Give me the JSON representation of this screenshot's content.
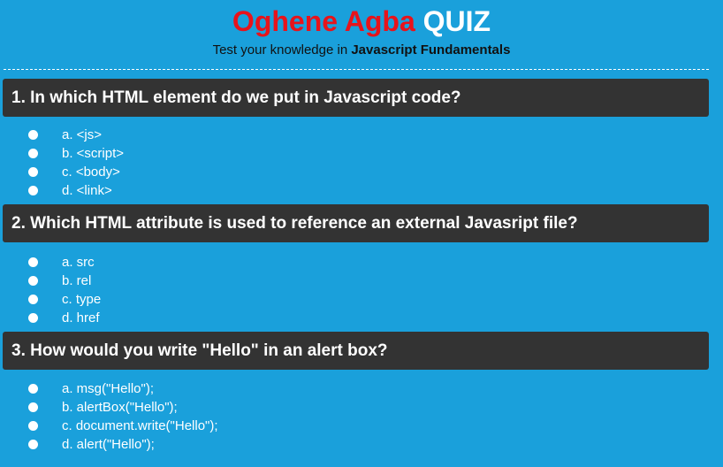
{
  "header": {
    "title_name": "Oghene Agba",
    "title_quiz": "QUIZ",
    "subtitle_prefix": "Test your knowledge in",
    "subtitle_topic": "Javascript Fundamentals"
  },
  "colors": {
    "background": "#1aa0db",
    "name_red": "#e8131b",
    "question_bar": "#333333"
  },
  "questions": [
    {
      "text": "1. In which HTML element do we put in Javascript code?",
      "options": [
        "a. <js>",
        "b. <script>",
        "c. <body>",
        "d. <link>"
      ]
    },
    {
      "text": "2. Which HTML attribute is used to reference an external Javasript file?",
      "options": [
        "a. src",
        "b. rel",
        "c. type",
        "d. href"
      ]
    },
    {
      "text": "3. How would you write \"Hello\" in an alert box?",
      "options": [
        "a. msg(\"Hello\");",
        "b. alertBox(\"Hello\");",
        "c. document.write(\"Hello\");",
        "d. alert(\"Hello\");"
      ]
    }
  ]
}
